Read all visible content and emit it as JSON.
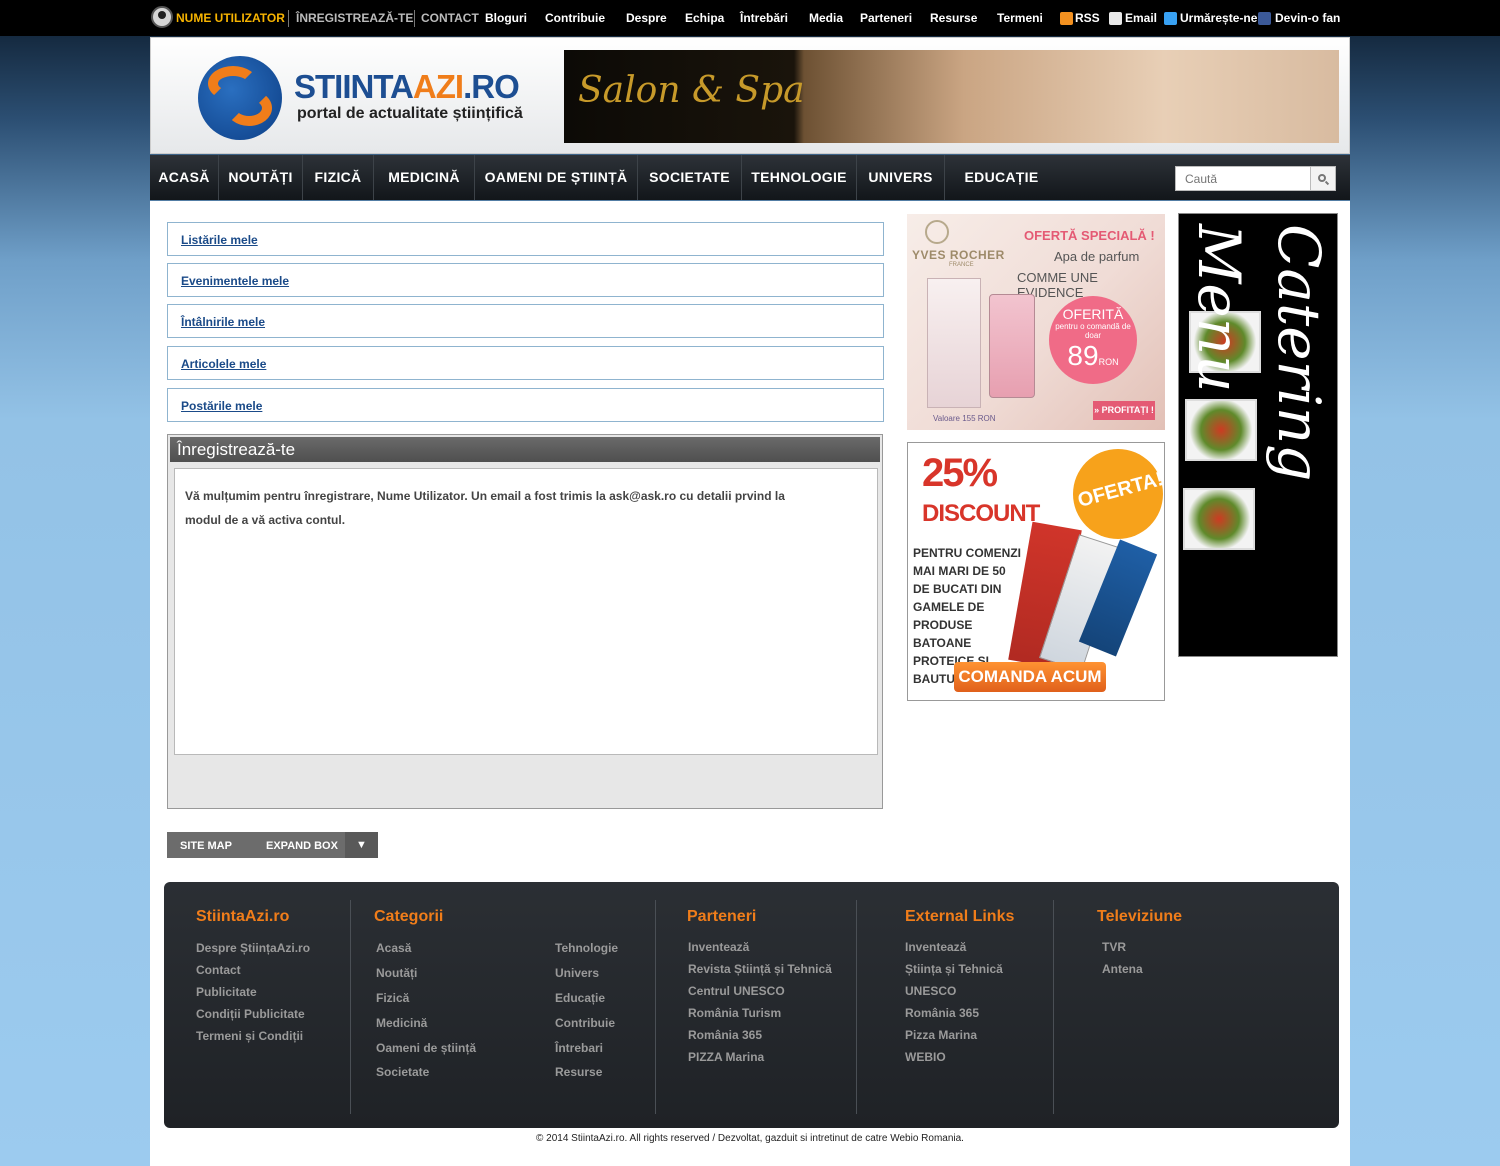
{
  "topbar": {
    "user_name": "NUME UTILIZATOR",
    "register": "ÎNREGISTREAZĂ-TE",
    "contact": "CONTACT",
    "links": [
      "Bloguri",
      "Contribuie",
      "Despre",
      "Echipa",
      "Întrebări",
      "Media",
      "Parteneri",
      "Resurse",
      "Termeni"
    ],
    "rss": "RSS",
    "email": "Email",
    "follow": "Urmărește-ne",
    "fan": "Devin-o fan"
  },
  "header": {
    "logo_title_main": "STIINTA",
    "logo_title_azi": "AZI",
    "logo_title_ro": ".RO",
    "logo_subtitle": "portal de actualitate științifică",
    "banner_text": "Salon & Spa"
  },
  "nav": {
    "items": [
      "ACASĂ",
      "NOUTĂȚI",
      "FIZICĂ",
      "MEDICINĂ",
      "OAMENI DE ȘTIINȚĂ",
      "SOCIETATE",
      "TEHNOLOGIE",
      "UNIVERS",
      "EDUCAȚIE"
    ],
    "search_placeholder": "Caută"
  },
  "my_links": [
    "Listările mele",
    "Evenimentele mele",
    "Întâlnirile mele",
    "Articolele mele",
    "Postările mele"
  ],
  "register": {
    "title": "Înregistrează-te",
    "message": "Vă mulțumim pentru înregistrare, Nume Utilizator. Un email a fost trimis la ask@ask.ro cu detalii prvind la modul de a vă activa contul."
  },
  "ads": {
    "yves": {
      "brand": "YVES ROCHER",
      "brand_sub": "FRANCE",
      "offer": "OFERTĂ SPECIALĂ !",
      "line1": "Apa de parfum",
      "line2": "COMME UNE EVIDENCE",
      "circle_title": "OFERITĂ",
      "circle_sub": "pentru o comandă de doar",
      "price": "89",
      "currency": "RON",
      "cta": "» PROFITAȚI !",
      "valoare": "Valoare 155 RON"
    },
    "discount": {
      "percent": "25%",
      "discount": "DISCOUNT",
      "oferta": "OFERTA!",
      "desc": "PENTRU COMENZI MAI MARI DE 50 DE BUCATI DIN GAMELE DE PRODUSE BATOANE PROTEICE SI BAUTURI INSTANT",
      "cta": "COMANDA ACUM"
    },
    "catering": {
      "text": "Catering Menu"
    }
  },
  "sitemap_bar": {
    "site_map": "SITE MAP",
    "expand_box": "EXPAND BOX",
    "arrow": "▼"
  },
  "footer": {
    "col1": {
      "title": "StiintaAzi.ro",
      "links": [
        "Despre ȘtiințaAzi.ro",
        "Contact",
        "Publicitate",
        "Condiții Publicitate",
        "Termeni și Condiții"
      ]
    },
    "col2": {
      "title": "Categorii",
      "links_a": [
        "Acasă",
        "Noutăți",
        "Fizică",
        "Medicină",
        "Oameni de știință",
        "Societate"
      ],
      "links_b": [
        "Tehnologie",
        "Univers",
        "Educație",
        "Contribuie",
        "Întrebari",
        "Resurse"
      ]
    },
    "col3": {
      "title": "Parteneri",
      "links": [
        "Inventează",
        "Revista Știință și Tehnică",
        "Centrul UNESCO",
        "România Turism",
        "România 365",
        "PIZZA Marina"
      ]
    },
    "col4": {
      "title": "External Links",
      "links": [
        "Inventează",
        "Știința și Tehnică",
        "UNESCO",
        "România 365",
        "Pizza Marina",
        "WEBIO"
      ]
    },
    "col5": {
      "title": "Televiziune",
      "links": [
        "TVR",
        "Antena"
      ]
    }
  },
  "copyright": "© 2014 StiintaAzi.ro. All rights reserved / Dezvoltat, gazduit si intretinut de catre Webio Romania.",
  "colors": {
    "accent_orange": "#f07d1a",
    "brand_blue": "#1d4e92",
    "link_blue": "#1a4a88",
    "user_yellow": "#f7b400"
  }
}
